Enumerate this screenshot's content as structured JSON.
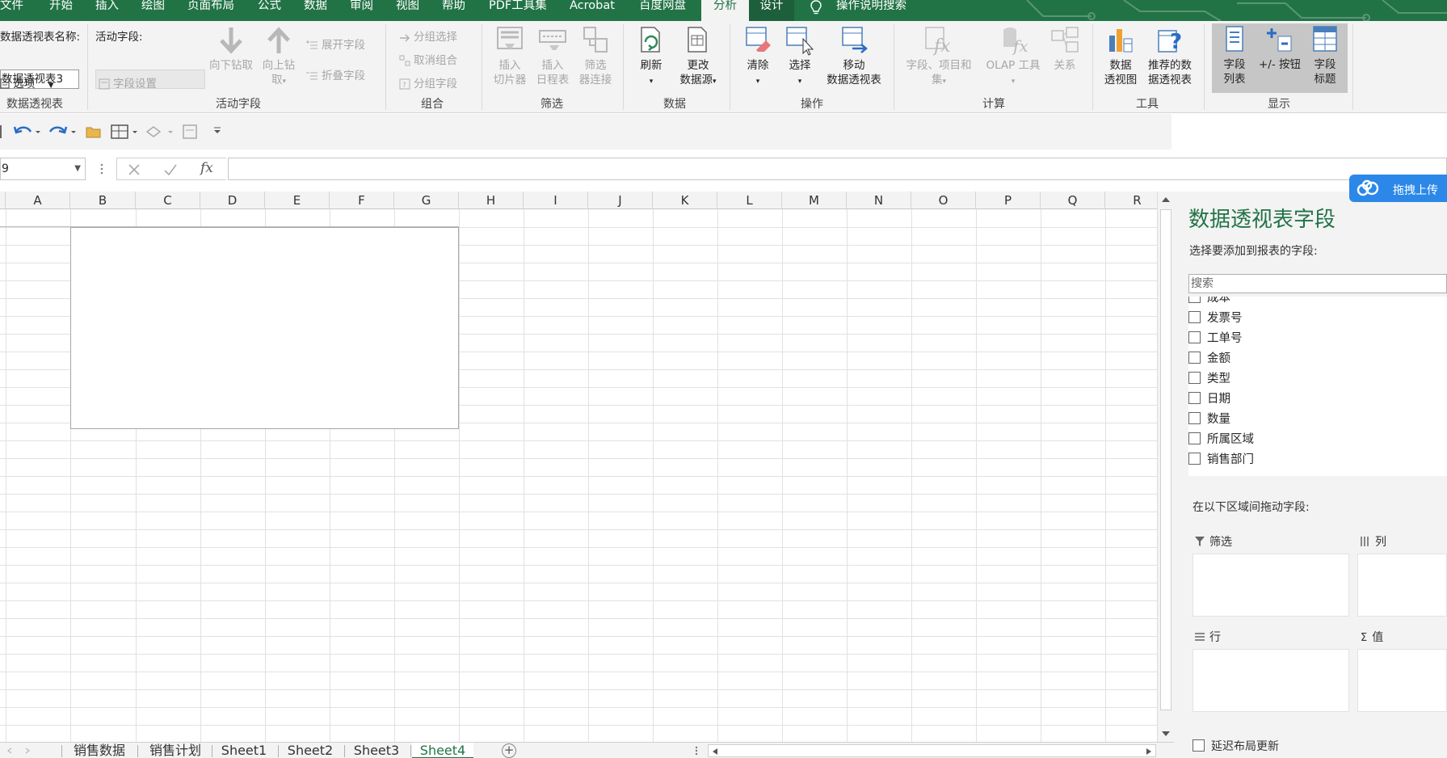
{
  "menu": {
    "tabs": [
      "文件",
      "开始",
      "插入",
      "绘图",
      "页面布局",
      "公式",
      "数据",
      "审阅",
      "视图",
      "帮助",
      "PDF工具集",
      "Acrobat",
      "百度网盘",
      "分析",
      "设计"
    ],
    "active_tab": "分析",
    "tell_me": "操作说明搜索"
  },
  "ribbon": {
    "pivot": {
      "name_label": "数据透视表名称:",
      "name_value": "数据透视表3",
      "options_label": "选项",
      "group_label": "数据透视表"
    },
    "active_field": {
      "label": "活动字段:",
      "field_settings": "字段设置",
      "drill_down": "向下钻取",
      "drill_up_1": "向上钻",
      "drill_up_2": "取",
      "expand": "展开字段",
      "collapse": "折叠字段",
      "group_label": "活动字段"
    },
    "group": {
      "group_selection": "分组选择",
      "ungroup": "取消组合",
      "group_field": "分组字段",
      "group_label": "组合"
    },
    "filter": {
      "slicer_1": "插入",
      "slicer_2": "切片器",
      "timeline_1": "插入",
      "timeline_2": "日程表",
      "conn_1": "筛选",
      "conn_2": "器连接",
      "group_label": "筛选"
    },
    "data": {
      "refresh": "刷新",
      "change_1": "更改",
      "change_2": "数据源",
      "group_label": "数据"
    },
    "actions": {
      "clear": "清除",
      "select": "选择",
      "move_1": "移动",
      "move_2": "数据透视表",
      "group_label": "操作"
    },
    "calc": {
      "fields_1": "字段、项目和",
      "fields_2": "集",
      "olap": "OLAP 工具",
      "relations": "关系",
      "group_label": "计算"
    },
    "tools": {
      "chart_1": "数据",
      "chart_2": "透视图",
      "recommend_1": "推荐的数",
      "recommend_2": "据透视表",
      "group_label": "工具"
    },
    "show": {
      "field_list_1": "字段",
      "field_list_2": "列表",
      "buttons": "+/- 按钮",
      "headers_1": "字段",
      "headers_2": "标题",
      "group_label": "显示"
    }
  },
  "formula_bar": {
    "name_box": "9",
    "fx_label": "fx",
    "value": ""
  },
  "grid": {
    "columns": [
      "A",
      "B",
      "C",
      "D",
      "E",
      "F",
      "G",
      "H",
      "I",
      "J",
      "K",
      "L",
      "M",
      "N",
      "O",
      "P",
      "Q",
      "R"
    ]
  },
  "sheets": {
    "tabs": [
      "销售数据",
      "销售计划",
      "Sheet1",
      "Sheet2",
      "Sheet3",
      "Sheet4"
    ],
    "active": "Sheet4"
  },
  "pane": {
    "title": "数据透视表字段",
    "subtitle": "选择要添加到报表的字段:",
    "search_placeholder": "搜索",
    "fields": [
      "成本",
      "发票号",
      "工单号",
      "金额",
      "类型",
      "日期",
      "数量",
      "所属区域",
      "销售部门"
    ],
    "drag_hint": "在以下区域间拖动字段:",
    "areas": {
      "filter": "筛选",
      "columns": "列",
      "rows": "行",
      "values": "值"
    },
    "defer_update": "延迟布局更新"
  },
  "baidu_badge": "拖拽上传",
  "colors": {
    "accent": "#217346",
    "pane_title": "#217346",
    "badge": "#2b88e8"
  }
}
